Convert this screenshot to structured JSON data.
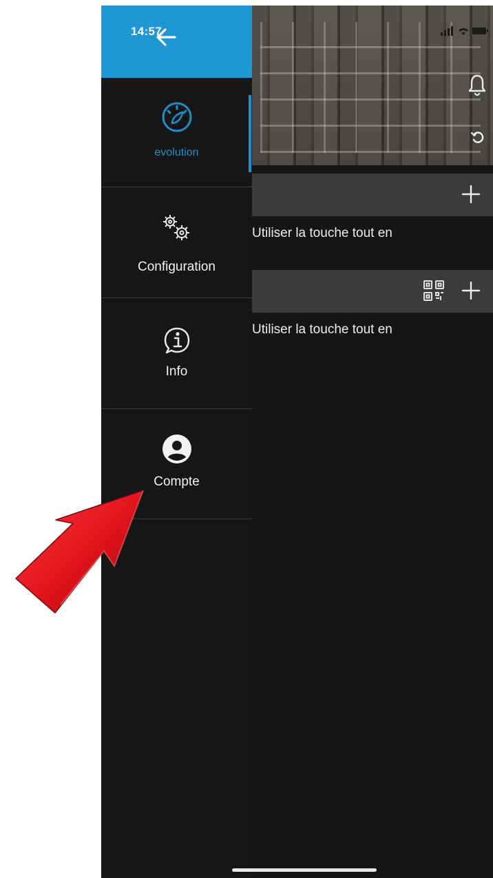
{
  "status_bar": {
    "time": "14:57"
  },
  "sidebar": {
    "items": [
      {
        "label": "evolution",
        "icon": "gauge-icon",
        "active": true
      },
      {
        "label": "Configuration",
        "icon": "gears-icon",
        "active": false
      },
      {
        "label": "Info",
        "icon": "info-icon",
        "active": false
      },
      {
        "label": "Compte",
        "icon": "account-icon",
        "active": false
      }
    ]
  },
  "main": {
    "hints": [
      {
        "text": "Utiliser la touche tout en"
      },
      {
        "text": "Utiliser la touche tout en"
      }
    ]
  },
  "colors": {
    "accent": "#1e97d4",
    "background": "#151515",
    "bar": "#3b3b3b",
    "pointer": "#e0121a"
  }
}
